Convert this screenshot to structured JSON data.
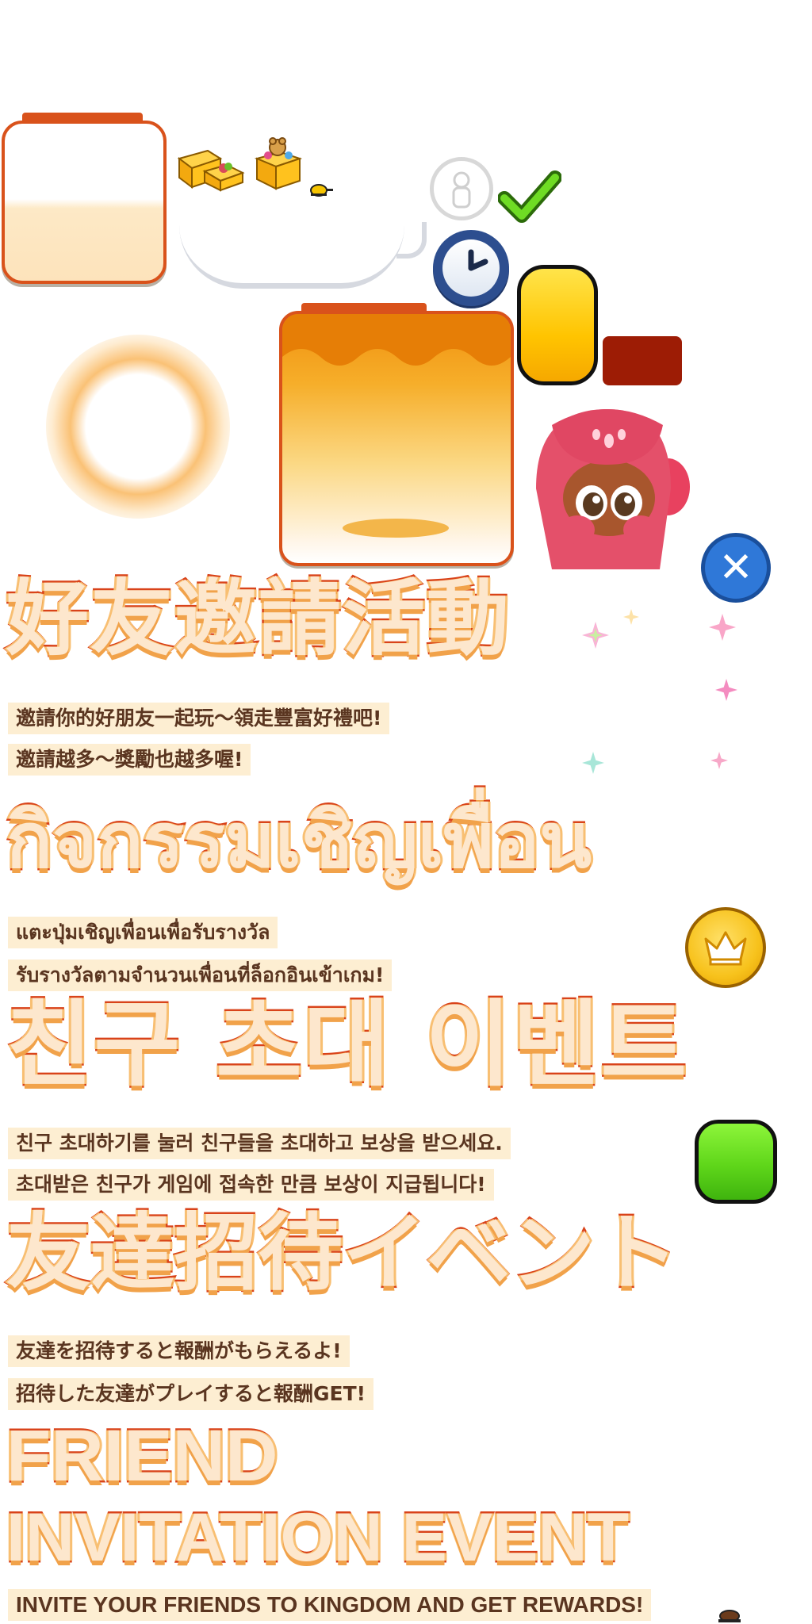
{
  "headings": {
    "chinese_traditional": "好友邀請活動",
    "thai": "กิจกรรมเชิญเพื่อน",
    "korean": "친구 초대 이벤트",
    "japanese": "友達招待イベント",
    "english_line1": "FRIEND",
    "english_line2": "INVITATION EVENT"
  },
  "captions": {
    "chinese_traditional": [
      "邀請你的好朋友一起玩～領走豐富好禮吧!",
      "邀請越多～獎勵也越多喔!"
    ],
    "thai": [
      "แตะปุ่มเชิญเพื่อนเพื่อรับรางวัล",
      "รับรางวัลตามจำนวนเพื่อนที่ล็อกอินเข้าเกม!"
    ],
    "korean": [
      "친구 초대하기를 눌러 친구들을 초대하고 보상을 받으세요.",
      "초대받은 친구가 게임에 접속한 만큼 보상이 지급됩니다!"
    ],
    "japanese": [
      "友達を招待すると報酬がもらえるよ!",
      "招待した友達がプレイすると報酬GET!"
    ],
    "english": [
      "INVITE YOUR FRIENDS TO KINGDOM AND GET REWARDS!"
    ]
  },
  "icons": {
    "close": "✕",
    "close_icon": "close-icon",
    "check_icon": "check-icon",
    "clock_icon": "clock-icon",
    "crown_icon": "crown-coin-icon",
    "silhouette_icon": "cookie-silhouette-icon",
    "chest_icon": "gift-chest-icon"
  },
  "colors": {
    "heading_fill": "#fde7cd",
    "heading_stroke": "#d9431a",
    "caption_bg": "#fdeed2",
    "caption_text": "#5a3520",
    "accent_orange": "#d9521b",
    "button_yellow": "#ffc400",
    "button_green": "#5fd61a",
    "close_blue": "#2f78d8"
  }
}
